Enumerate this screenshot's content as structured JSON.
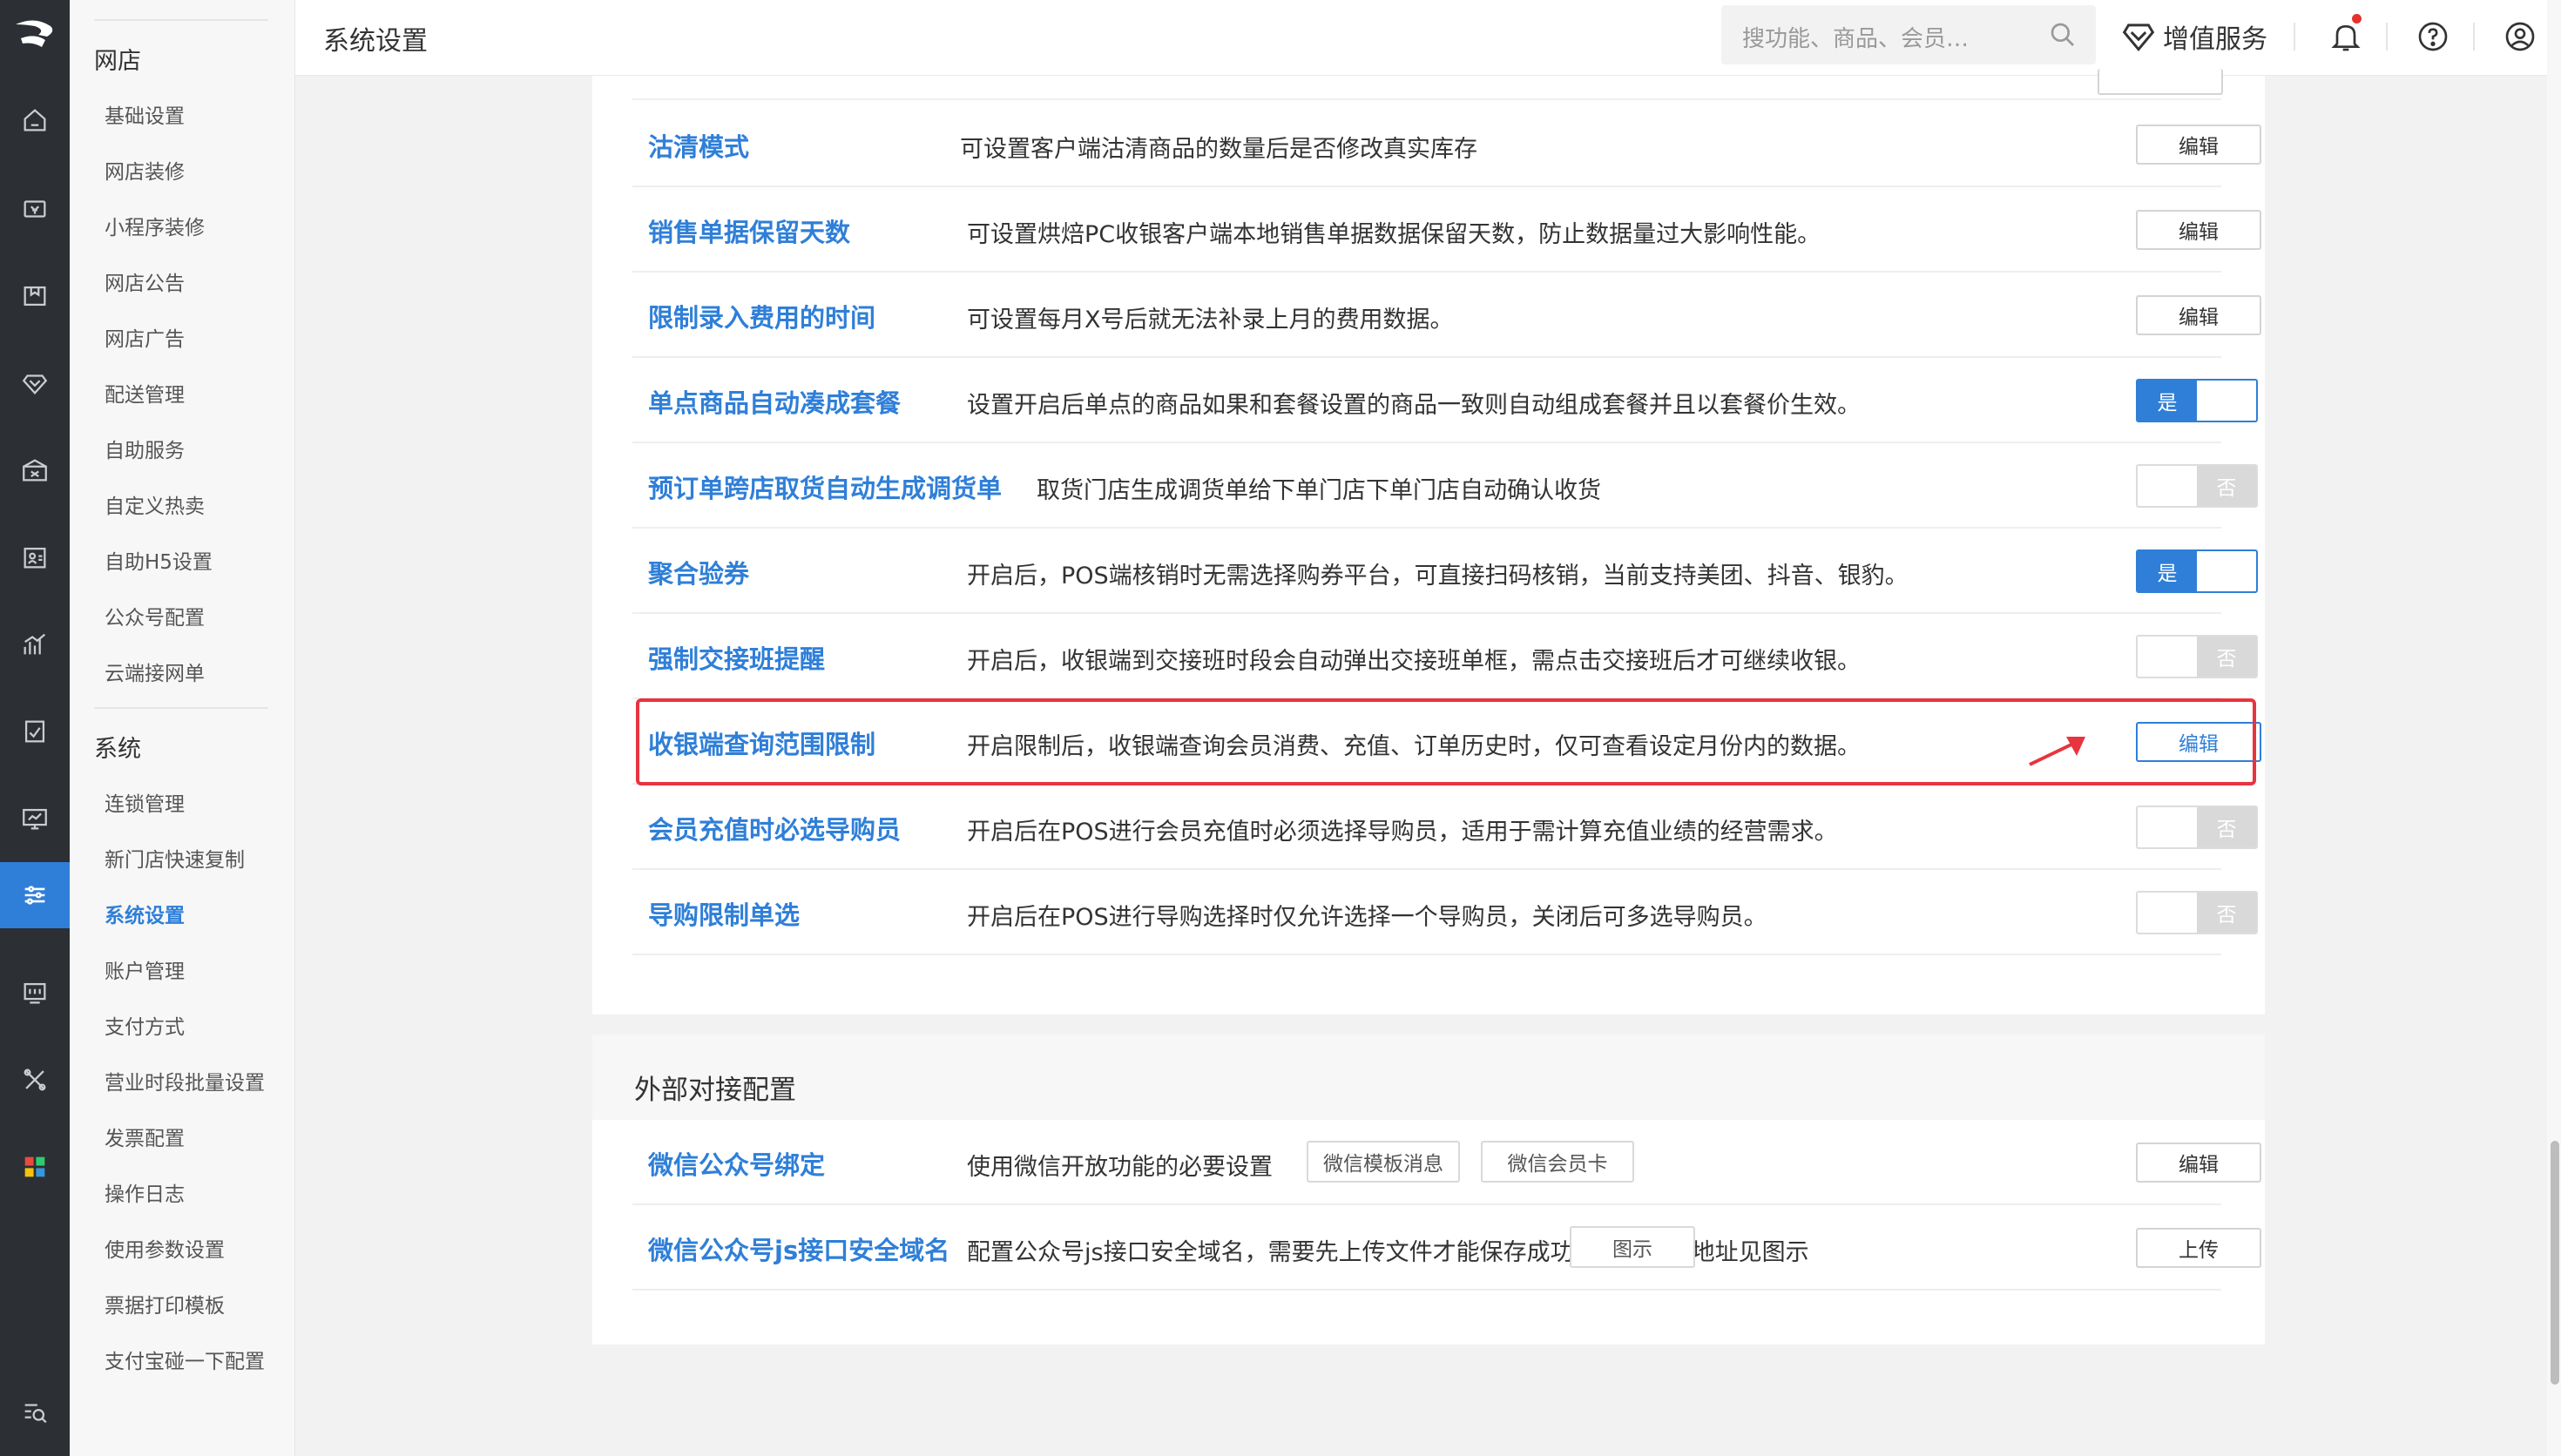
{
  "header": {
    "title": "系统设置",
    "search_placeholder": "搜功能、商品、会员…",
    "vip_label": "增值服务"
  },
  "sidebar": {
    "groups": [
      {
        "label": "网店",
        "items": [
          "基础设置",
          "网店装修",
          "小程序装修",
          "网店公告",
          "网店广告",
          "配送管理",
          "自助服务",
          "自定义热卖",
          "自助H5设置",
          "公众号配置",
          "云端接网单"
        ]
      },
      {
        "label": "系统",
        "items": [
          "连锁管理",
          "新门店快速复制",
          "系统设置",
          "账户管理",
          "支付方式",
          "营业时段批量设置",
          "发票配置",
          "操作日志",
          "使用参数设置",
          "票据打印模板",
          "支付宝碰一下配置"
        ]
      }
    ],
    "active_item": "系统设置"
  },
  "settings": [
    {
      "name": "沽清模式",
      "desc": "可设置客户端沽清商品的数量后是否修改真实库存",
      "control": "button",
      "label": "编辑"
    },
    {
      "name": "销售单据保留天数",
      "desc": "可设置烘焙PC收银客户端本地销售单据数据保留天数，防止数据量过大影响性能。",
      "control": "button",
      "label": "编辑"
    },
    {
      "name": "限制录入费用的时间",
      "desc": "可设置每月X号后就无法补录上月的费用数据。",
      "control": "button",
      "label": "编辑"
    },
    {
      "name": "单点商品自动凑成套餐",
      "desc": "设置开启后单点的商品如果和套餐设置的商品一致则自动组成套餐并且以套餐价生效。",
      "control": "toggle",
      "state": "on",
      "label": "是"
    },
    {
      "name": "预订单跨店取货自动生成调货单",
      "desc": "取货门店生成调货单给下单门店下单门店自动确认收货",
      "control": "toggle",
      "state": "off",
      "label": "否"
    },
    {
      "name": "聚合验券",
      "desc": "开启后，POS端核销时无需选择购券平台，可直接扫码核销，当前支持美团、抖音、银豹。",
      "control": "toggle",
      "state": "on",
      "label": "是"
    },
    {
      "name": "强制交接班提醒",
      "desc": "开启后，收银端到交接班时段会自动弹出交接班单框，需点击交接班后才可继续收银。",
      "control": "toggle",
      "state": "off",
      "label": "否"
    },
    {
      "name": "收银端查询范围限制",
      "desc": "开启限制后，收银端查询会员消费、充值、订单历史时，仅可查看设定月份内的数据。",
      "control": "button",
      "label": "编辑",
      "highlighted": true
    },
    {
      "name": "会员充值时必选导购员",
      "desc": "开启后在POS进行会员充值时必须选择导购员，适用于需计算充值业绩的经营需求。",
      "control": "toggle",
      "state": "off",
      "label": "否"
    },
    {
      "name": "导购限制单选",
      "desc": "开启后在POS进行导购选择时仅允许选择一个导购员，关闭后可多选导购员。",
      "control": "toggle",
      "state": "off",
      "label": "否"
    }
  ],
  "external": {
    "title": "外部对接配置",
    "rows": [
      {
        "name": "微信公众号绑定",
        "desc": "使用微信开放功能的必要设置",
        "tags": [
          "微信模板消息",
          "微信会员卡"
        ],
        "button": "编辑"
      },
      {
        "name": "微信公众号js接口安全域名",
        "desc": "配置公众号js接口安全域名，需要先上传文件才能保存成功，文件下载地址见图示",
        "tags": [
          "图示"
        ],
        "button": "上传"
      }
    ]
  },
  "colors": {
    "accent": "#2f7fd8",
    "highlight": "#e8343f",
    "rail": "#2c2f33"
  },
  "icons": [
    "logo-icon",
    "home-icon",
    "cashier-icon",
    "goods-icon",
    "member-icon",
    "promotion-icon",
    "staff-icon",
    "report-icon",
    "order-icon",
    "screen-icon",
    "settings-icon",
    "device-icon",
    "tools-icon",
    "apps-icon",
    "search-icon",
    "diamond-icon",
    "bell-icon",
    "help-icon",
    "user-icon",
    "arrow-icon"
  ]
}
